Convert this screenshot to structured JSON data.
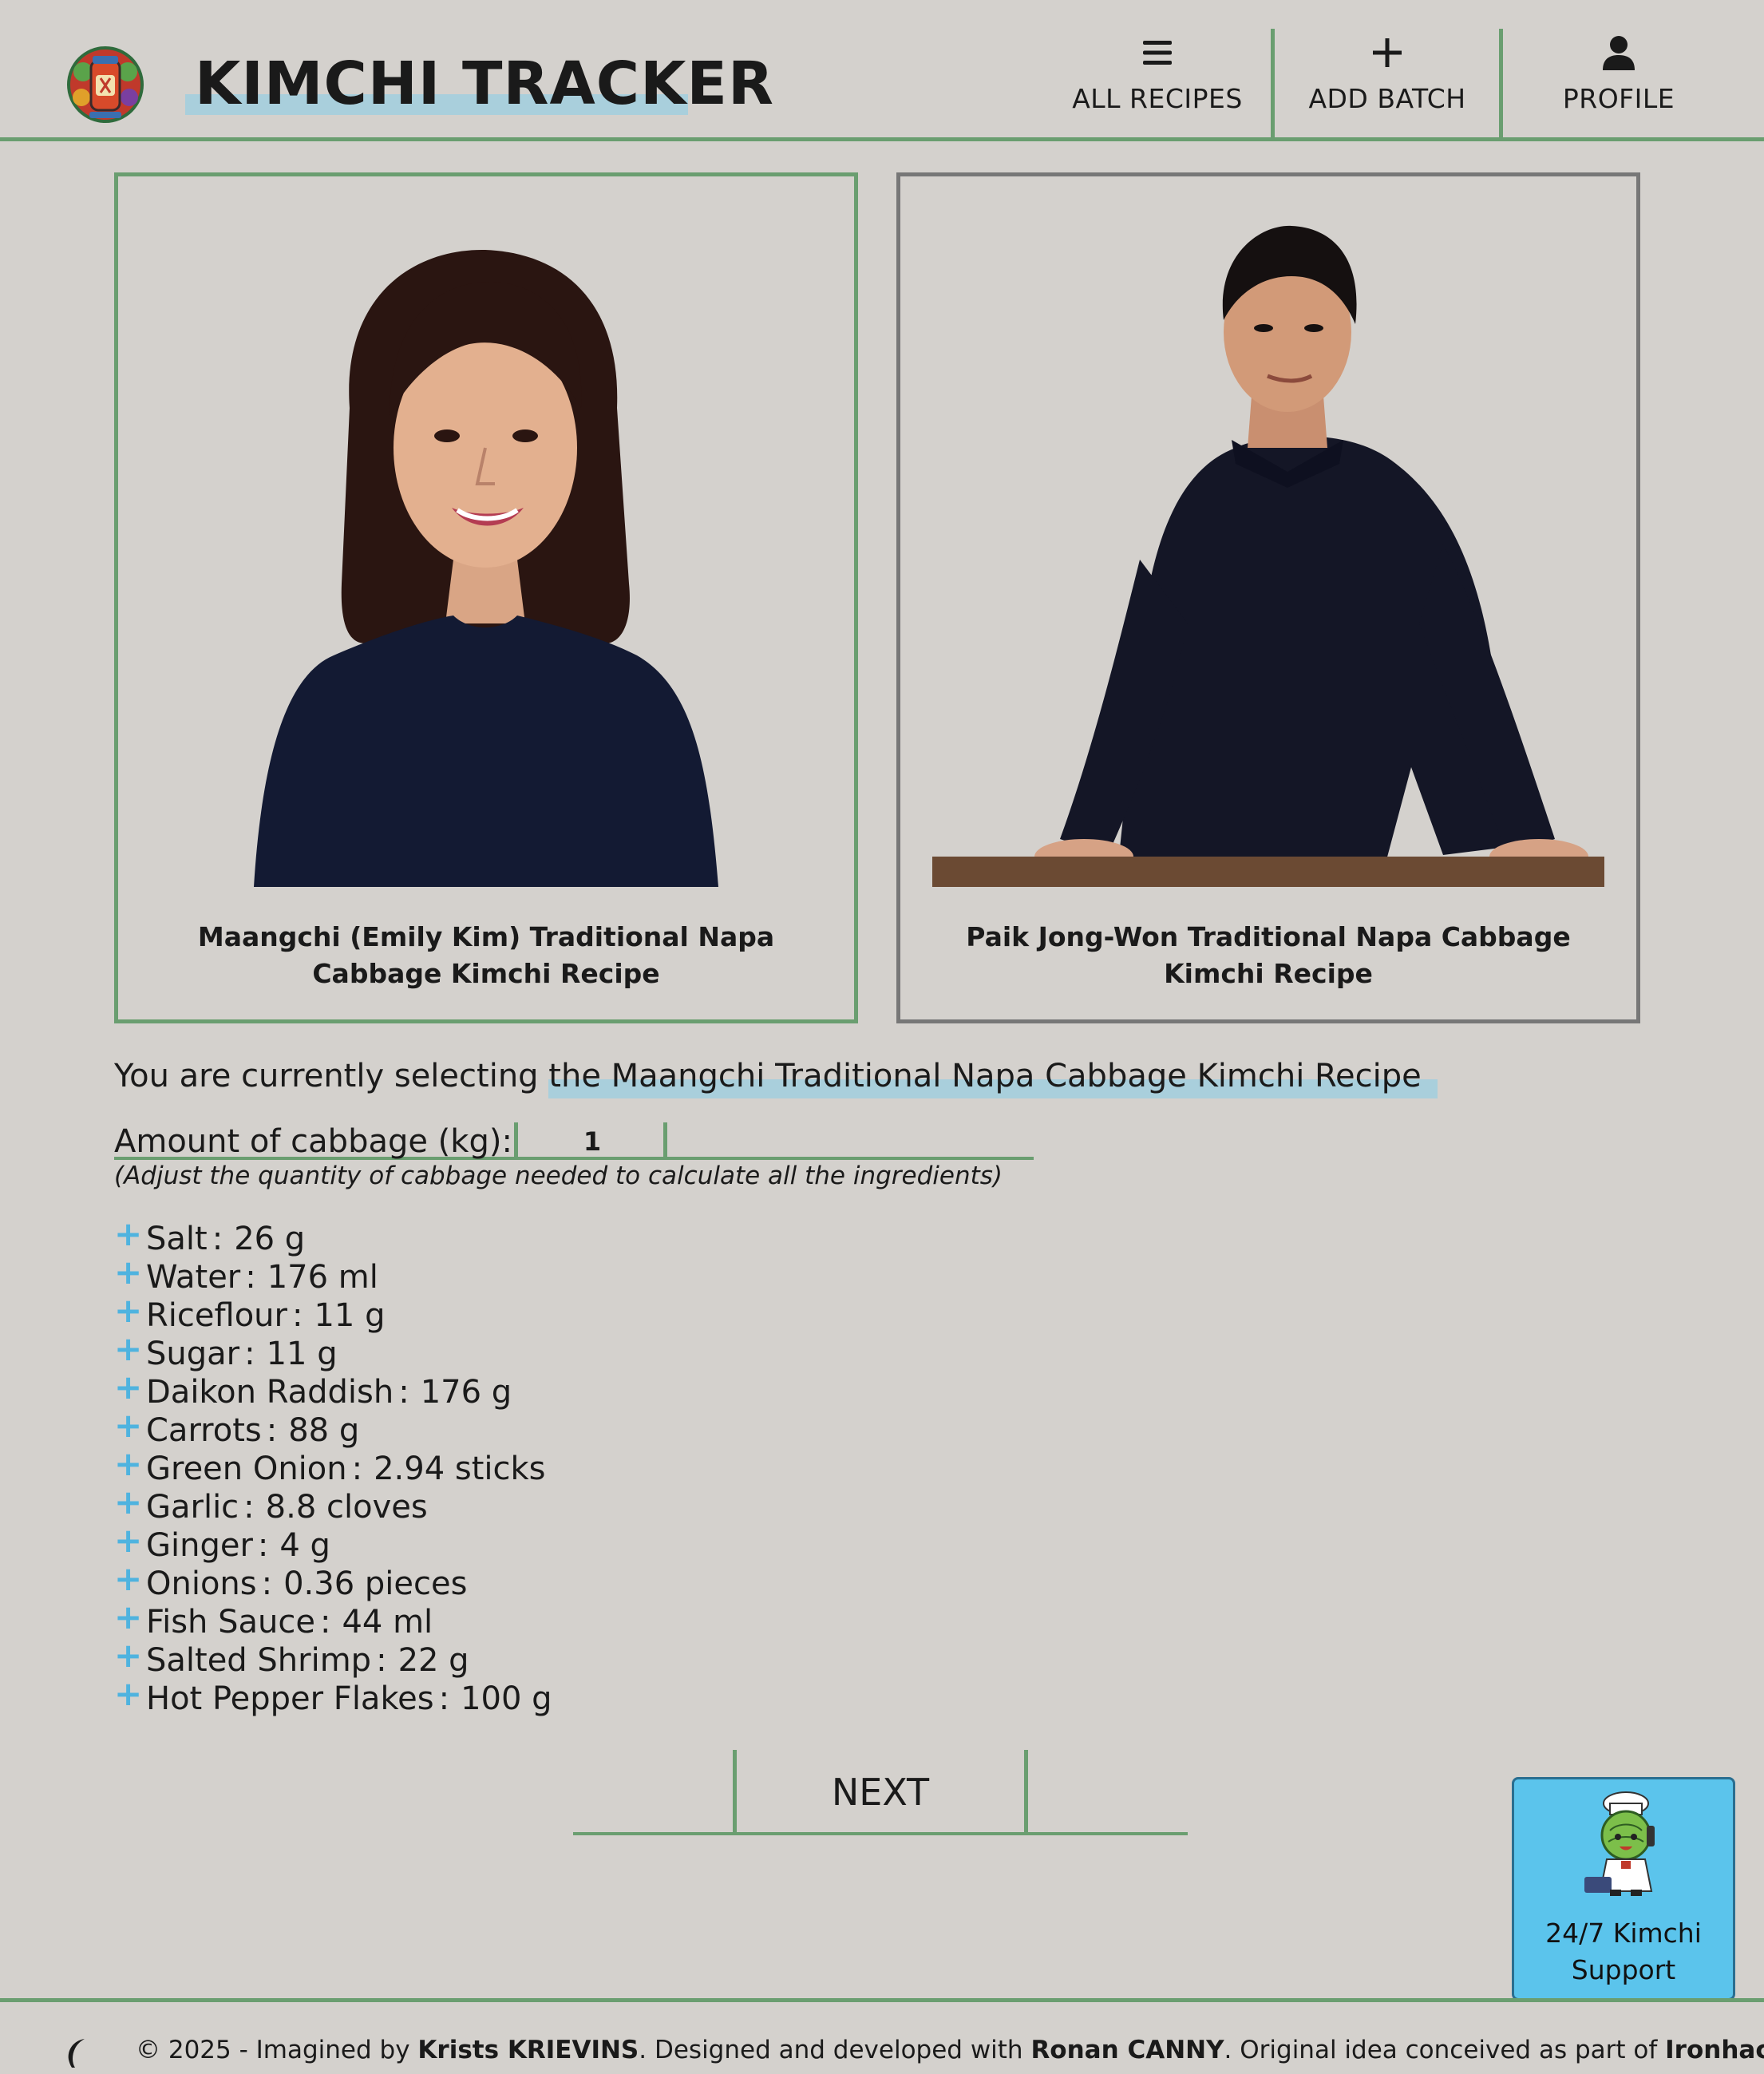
{
  "header": {
    "brand": "KIMCHI TRACKER",
    "nav": [
      {
        "label": "ALL RECIPES",
        "icon": "menu-icon"
      },
      {
        "label": "ADD BATCH",
        "icon": "plus-icon"
      },
      {
        "label": "PROFILE",
        "icon": "user-icon"
      }
    ]
  },
  "recipes": [
    {
      "caption": "Maangchi (Emily Kim) Traditional Napa Cabbage Kimchi Recipe",
      "selected": true
    },
    {
      "caption": "Paik Jong-Won Traditional Napa Cabbage Kimchi Recipe",
      "selected": false
    }
  ],
  "selection": {
    "prefix": "You are currently selecting",
    "recipe": "the Maangchi Traditional Napa Cabbage Kimchi Recipe"
  },
  "amount": {
    "label": "Amount of cabbage (kg):",
    "value": "1",
    "hint": "(Adjust the quantity of cabbage needed to calculate all the ingredients)"
  },
  "ingredients": [
    {
      "name": "Salt",
      "qty": "26 g"
    },
    {
      "name": "Water",
      "qty": "176 ml"
    },
    {
      "name": "Riceflour",
      "qty": "11 g"
    },
    {
      "name": "Sugar",
      "qty": "11 g"
    },
    {
      "name": "Daikon Raddish",
      "qty": "176 g"
    },
    {
      "name": "Carrots",
      "qty": "88 g"
    },
    {
      "name": "Green Onion",
      "qty": "2.94 sticks"
    },
    {
      "name": "Garlic",
      "qty": "8.8 cloves"
    },
    {
      "name": "Ginger",
      "qty": "4 g"
    },
    {
      "name": "Onions",
      "qty": "0.36 pieces"
    },
    {
      "name": "Fish Sauce",
      "qty": "44 ml"
    },
    {
      "name": "Salted Shrimp",
      "qty": "22 g"
    },
    {
      "name": "Hot Pepper Flakes",
      "qty": "100 g"
    }
  ],
  "ingredient_separator": ":",
  "next_label": "NEXT",
  "support": {
    "line1": "24/7 Kimchi",
    "line2": "Support"
  },
  "footer": {
    "t1": "© 2025 - Imagined by ",
    "b1": "Krists KRIEVINS",
    "t2": ". Designed and developed with ",
    "b2": "Ronan CANNY",
    "t3": ". Original idea conceived as part of ",
    "b3": "Ironhack's"
  },
  "colors": {
    "background": "#d4d1cd",
    "accent_green": "#6a9e70",
    "highlight": "#a9cfdc",
    "plus_blue": "#4fb3df",
    "support_bg": "#5bc4ec"
  }
}
